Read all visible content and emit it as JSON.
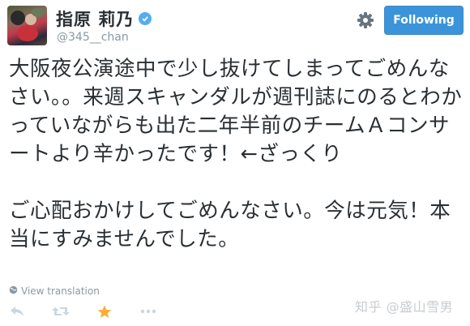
{
  "profile": {
    "display_name": "指原 莉乃",
    "handle": "@345__chan"
  },
  "actions": {
    "follow_label": "Following"
  },
  "tweet": {
    "text": "大阪夜公演途中で少し抜けてしまってごめんなさい。。来週スキャンダルが週刊誌にのるとわかっていながらも出た二年半前のチームＡコンサートより辛かったです！←ざっくり\n\nご心配おかけしてごめんなさい。今は元気！本当にすみませんでした。",
    "view_translation": "View translation"
  },
  "watermark": {
    "text": "知乎 @盛山雪男"
  },
  "colors": {
    "follow_button": "#3b94d9",
    "verified_badge": "#55acee",
    "favorite_star": "#ffac33"
  }
}
